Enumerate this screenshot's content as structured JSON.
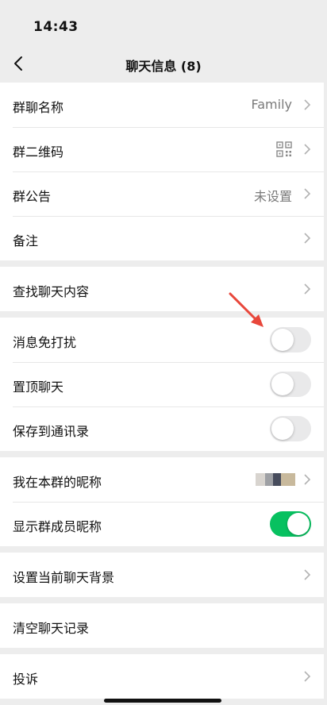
{
  "status": {
    "time": "14:43"
  },
  "nav": {
    "title": "聊天信息 (8)",
    "back_icon": "chevron-left-icon"
  },
  "rows": {
    "group_name": {
      "label": "群聊名称",
      "value": "Family"
    },
    "group_qr": {
      "label": "群二维码",
      "icon": "qr-code-icon"
    },
    "group_notice": {
      "label": "群公告",
      "value": "未设置"
    },
    "remark": {
      "label": "备注"
    },
    "search_content": {
      "label": "查找聊天内容"
    },
    "mute": {
      "label": "消息免打扰",
      "on": false
    },
    "sticky": {
      "label": "置顶聊天",
      "on": false
    },
    "save_contacts": {
      "label": "保存到通讯录",
      "on": false
    },
    "my_nickname": {
      "label": "我在本群的昵称"
    },
    "show_member_names": {
      "label": "显示群成员昵称",
      "on": true
    },
    "set_background": {
      "label": "设置当前聊天背景"
    },
    "clear_history": {
      "label": "清空聊天记录"
    },
    "complain": {
      "label": "投诉"
    }
  },
  "colors": {
    "accent_green": "#07c160",
    "annotation_red": "#e8473b",
    "background": "#ededed"
  }
}
